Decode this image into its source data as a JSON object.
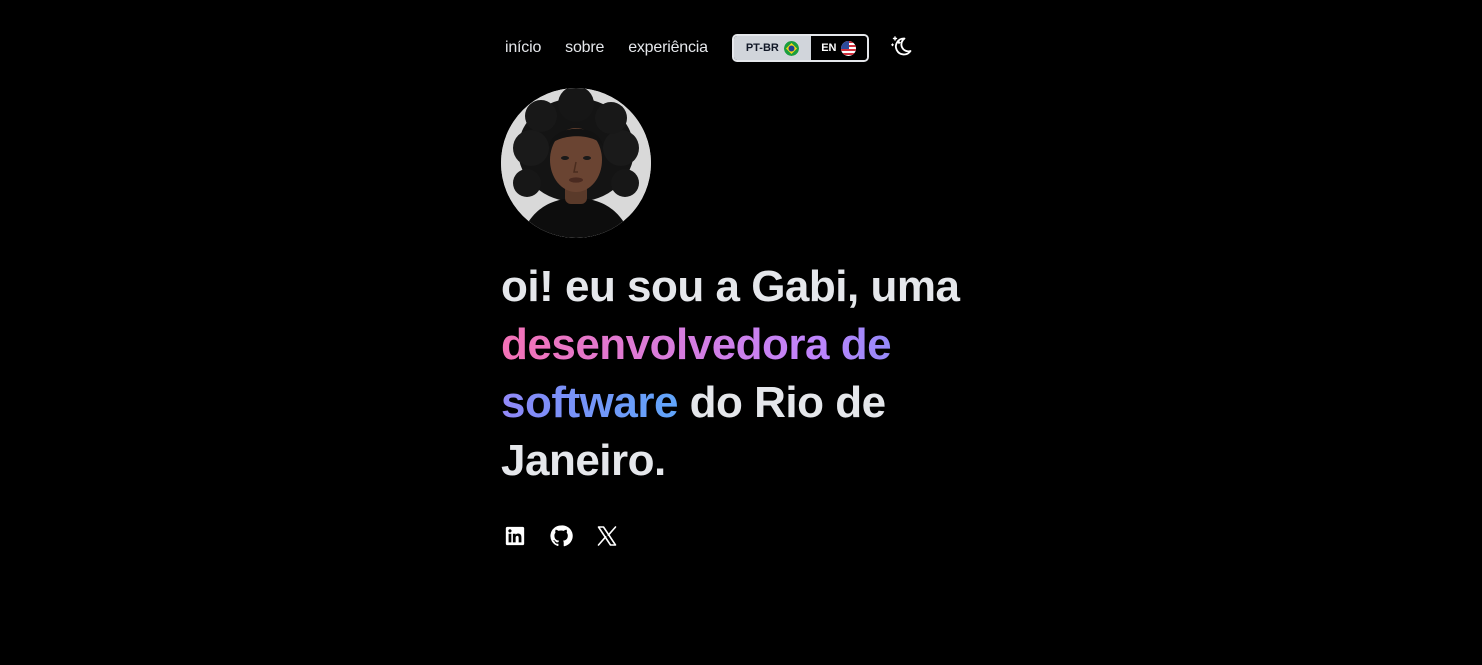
{
  "nav": {
    "links": [
      {
        "label": "início"
      },
      {
        "label": "sobre"
      },
      {
        "label": "experiência"
      }
    ],
    "language": {
      "options": [
        {
          "label": "PT-BR",
          "flag": "brazil-flag-icon",
          "selected": true
        },
        {
          "label": "EN",
          "flag": "usa-flag-icon",
          "selected": false
        }
      ]
    },
    "theme_toggle": {
      "icon": "moon-stars-icon"
    }
  },
  "avatar": {
    "icon": "profile-photo"
  },
  "hero": {
    "intro": "oi! eu sou a Gabi, uma",
    "highlight": "desenvolvedora de software",
    "outro": " do Rio de Janeiro."
  },
  "socials": [
    {
      "icon": "linkedin-icon"
    },
    {
      "icon": "github-icon"
    },
    {
      "icon": "x-twitter-icon"
    }
  ],
  "colors": {
    "background": "#000000",
    "text": "#e5e7eb",
    "gradient_start": "#f472b6",
    "gradient_mid": "#c084fc",
    "gradient_end": "#60a5fa"
  }
}
